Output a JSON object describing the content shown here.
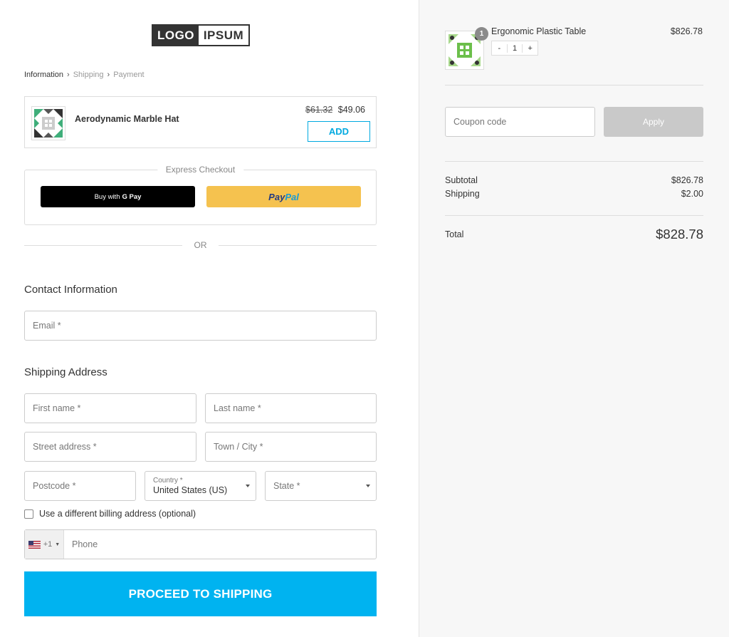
{
  "logo": {
    "part1": "LOGO",
    "part2": "IPSUM"
  },
  "breadcrumb": {
    "step1": "Information",
    "step2": "Shipping",
    "step3": "Payment"
  },
  "upsell": {
    "name": "Aerodynamic Marble Hat",
    "old_price": "$61.32",
    "new_price": "$49.06",
    "add_label": "ADD"
  },
  "express": {
    "legend": "Express Checkout",
    "gpay_prefix": "Buy with",
    "gpay_logo": "G Pay",
    "paypal_part1": "Pay",
    "paypal_part2": "Pal"
  },
  "or_label": "OR",
  "contact": {
    "title": "Contact Information",
    "email_placeholder": "Email *"
  },
  "shipping": {
    "title": "Shipping Address",
    "first_name": "First name *",
    "last_name": "Last name *",
    "street": "Street address *",
    "town": "Town / City *",
    "postcode": "Postcode *",
    "country_label": "Country *",
    "country_value": "United States (US)",
    "state": "State *"
  },
  "billing_label": "Use a different billing address (optional)",
  "phone": {
    "code": "+1",
    "placeholder": "Phone"
  },
  "proceed_label": "PROCEED TO SHIPPING",
  "cart": {
    "item_name": "Ergonomic Plastic Table",
    "item_price": "$826.78",
    "badge": "1",
    "qty": "1",
    "minus": "-",
    "plus": "+"
  },
  "coupon": {
    "placeholder": "Coupon code",
    "apply_label": "Apply"
  },
  "totals": {
    "subtotal_label": "Subtotal",
    "subtotal": "$826.78",
    "shipping_label": "Shipping",
    "shipping": "$2.00",
    "total_label": "Total",
    "total": "$828.78"
  },
  "colors": {
    "accent": "#00b3f0",
    "paypal": "#f5c24f",
    "apply_disabled": "#c9c9c9"
  }
}
